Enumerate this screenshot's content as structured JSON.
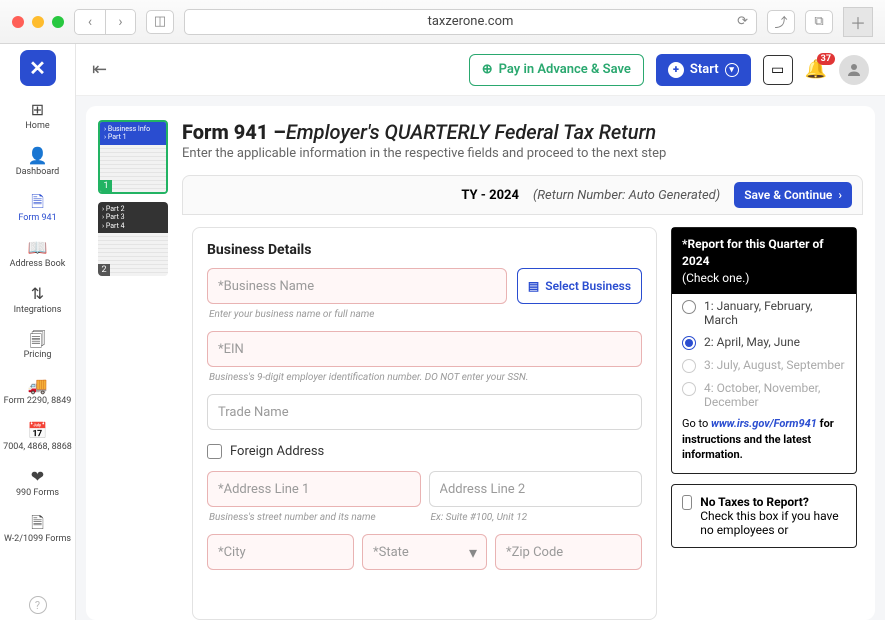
{
  "browser": {
    "url": "taxzerone.com",
    "notif_count": "37"
  },
  "topbar": {
    "pay_label": "Pay in Advance & Save",
    "start_label": "Start"
  },
  "rail": {
    "items": [
      {
        "icon": "⊞",
        "label": "Home"
      },
      {
        "icon": "👤",
        "label": "Dashboard"
      },
      {
        "icon": "🗎",
        "label": "Form 941"
      },
      {
        "icon": "📖",
        "label": "Address Book"
      },
      {
        "icon": "⇅",
        "label": "Integrations"
      },
      {
        "icon": "🗐",
        "label": "Pricing"
      },
      {
        "icon": "🚚",
        "label": "Form 2290, 8849"
      },
      {
        "icon": "📅",
        "label": "7004, 4868, 8868"
      },
      {
        "icon": "❤",
        "label": "990 Forms"
      },
      {
        "icon": "🗎",
        "label": "W-2/1099 Forms"
      }
    ]
  },
  "thumbs": [
    {
      "lines": [
        "› Business Info",
        "› Part 1"
      ],
      "num": "1"
    },
    {
      "lines": [
        "› Part 2",
        "› Part 3",
        "› Part 4"
      ],
      "num": "2"
    }
  ],
  "page": {
    "title_bold": "Form 941 –",
    "title_italic": "Employer's QUARTERLY Federal Tax Return",
    "subtitle": "Enter the applicable information in the respective fields and proceed to the next step",
    "ty": "TY - 2024",
    "return_number": "(Return Number: Auto Generated)",
    "save_continue": "Save & Continue"
  },
  "biz": {
    "section": "Business Details",
    "name_ph": "*Business Name",
    "name_hint": "Enter your business name or full name",
    "select_biz": "Select Business",
    "ein_ph": "*EIN",
    "ein_hint": "Business's 9-digit employer identification number. DO NOT enter your SSN.",
    "trade_ph": "Trade Name",
    "foreign": "Foreign Address",
    "addr1_ph": "*Address Line 1",
    "addr1_hint": "Business's street number and its name",
    "addr2_ph": "Address Line 2",
    "addr2_hint": "Ex: Suite #100, Unit 12",
    "city_ph": "*City",
    "state_ph": "*State",
    "zip_ph": "*Zip Code"
  },
  "quarter": {
    "head_l1": "*Report for this Quarter of 2024",
    "head_l2": "(Check one.)",
    "opts": [
      "1: January, February, March",
      "2: April, May, June",
      "3: July, August, September",
      "4: October, November, December"
    ],
    "go_to": "Go to ",
    "link": "www.irs.gov/Form941",
    "after": " for instructions and the latest information."
  },
  "notax": {
    "title": "No Taxes to Report?",
    "body": "Check this box if you have no employees or"
  }
}
